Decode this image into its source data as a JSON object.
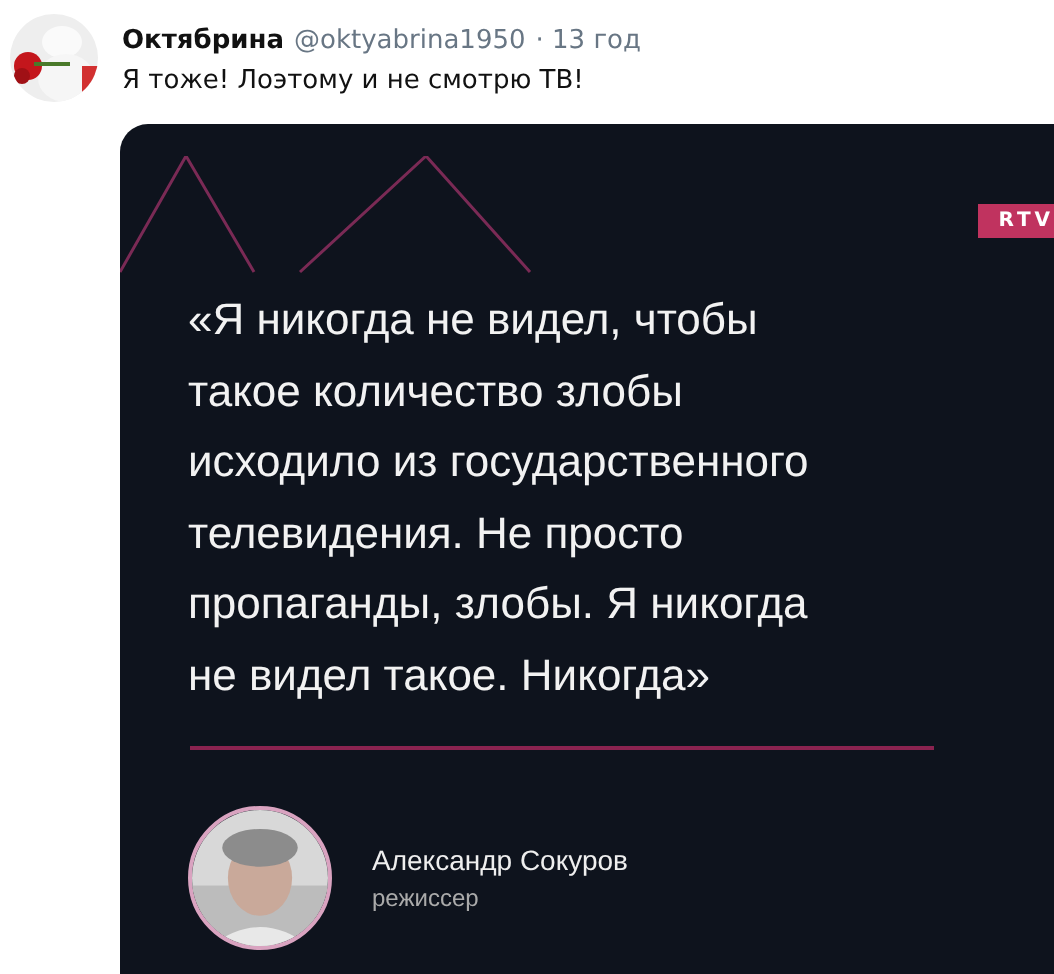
{
  "tweet": {
    "author": "Октябрина",
    "handle": "@oktyabrina1950",
    "time": "· 13 год",
    "text": "Я тоже! Лоэтому и не смотрю ТВ!"
  },
  "card": {
    "badge": "RTV",
    "quote_lines": [
      "«Я никогда не видел, чтобы",
      "такое количество злобы",
      "исходило из государственного",
      "телевидения. Не просто",
      "пропаганды, злобы. Я никогда",
      "не видел такое. Никогда»"
    ],
    "person_name": "Александр Сокуров",
    "person_role": "режиссер"
  }
}
